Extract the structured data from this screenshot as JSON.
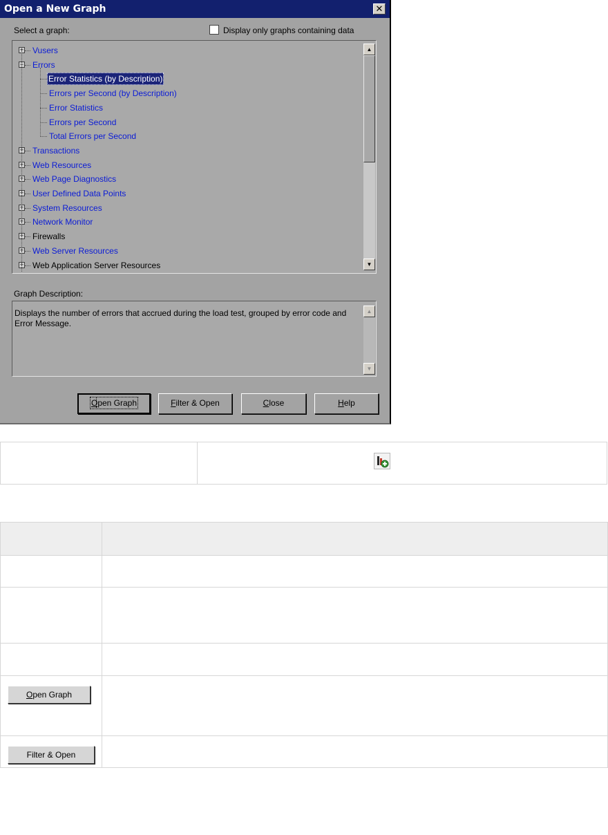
{
  "dialog": {
    "title": "Open a New Graph",
    "close_glyph": "✕",
    "select_label": "Select a graph:",
    "checkbox_label": "Display only graphs containing data",
    "tree": [
      {
        "label": "Vusers",
        "level": 0,
        "expander": "+",
        "color": "blue"
      },
      {
        "label": "Errors",
        "level": 0,
        "expander": "−",
        "color": "blue"
      },
      {
        "label": "Error Statistics (by Description)",
        "level": 1,
        "selected": true
      },
      {
        "label": "Errors per Second (by Description)",
        "level": 1,
        "color": "blue"
      },
      {
        "label": "Error Statistics",
        "level": 1,
        "color": "blue"
      },
      {
        "label": "Errors per Second",
        "level": 1,
        "color": "blue"
      },
      {
        "label": "Total Errors per Second",
        "level": 1,
        "color": "blue"
      },
      {
        "label": "Transactions",
        "level": 0,
        "expander": "+",
        "color": "blue"
      },
      {
        "label": "Web Resources",
        "level": 0,
        "expander": "+",
        "color": "blue"
      },
      {
        "label": "Web Page Diagnostics",
        "level": 0,
        "expander": "+",
        "color": "blue"
      },
      {
        "label": "User Defined Data Points",
        "level": 0,
        "expander": "+",
        "color": "blue"
      },
      {
        "label": "System Resources",
        "level": 0,
        "expander": "+",
        "color": "blue"
      },
      {
        "label": "Network Monitor",
        "level": 0,
        "expander": "+",
        "color": "blue"
      },
      {
        "label": "Firewalls",
        "level": 0,
        "expander": "+",
        "color": "black"
      },
      {
        "label": "Web Server Resources",
        "level": 0,
        "expander": "+",
        "color": "blue"
      },
      {
        "label": "Web Application Server Resources",
        "level": 0,
        "expander": "+",
        "color": "black"
      }
    ],
    "description_label": "Graph Description:",
    "description_text": "Displays the number of errors that accrued during the load test, grouped by error code and Error Message.",
    "buttons": {
      "open_graph": {
        "accel": "O",
        "rest": "pen Graph"
      },
      "filter_open": {
        "accel": "F",
        "rest": "ilter & Open"
      },
      "close": {
        "accel": "C",
        "rest": "lose"
      },
      "help": {
        "accel": "H",
        "rest": "elp"
      }
    }
  },
  "icon_table": {
    "icon": "add-graph-icon"
  },
  "ui_table": {
    "open_graph_button": {
      "accel": "O",
      "rest": "pen Graph"
    },
    "filter_open_button_label": "Filter & Open"
  },
  "colors": {
    "dialog_bg": "#a3a3a3",
    "titlebar_bg": "#12206e",
    "tree_link": "#0a1bd6",
    "selection_bg": "#1b2478"
  }
}
